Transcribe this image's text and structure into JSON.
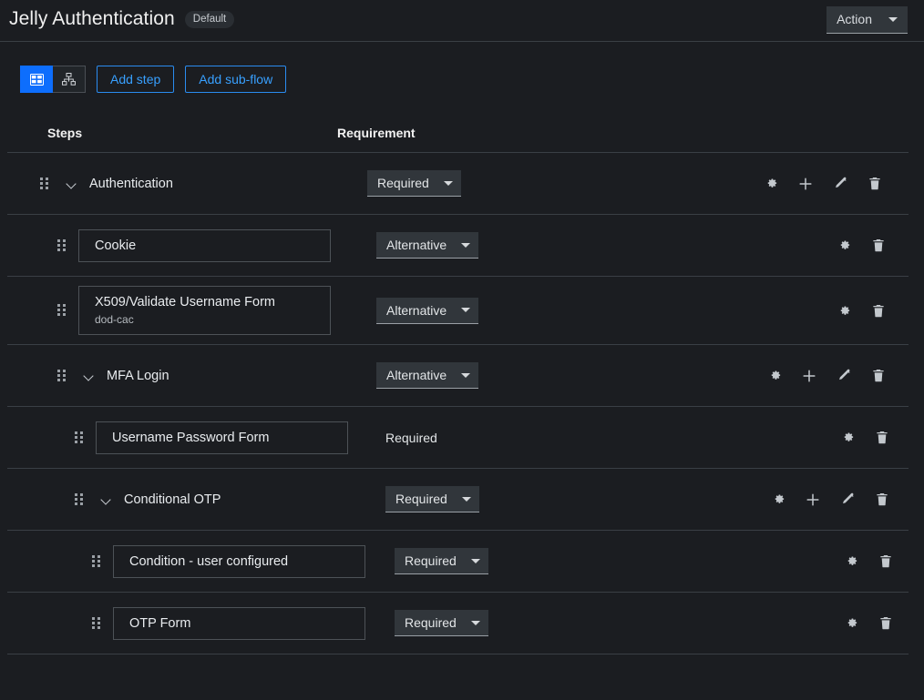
{
  "header": {
    "title": "Jelly Authentication",
    "badge": "Default",
    "action_label": "Action",
    "action_icon": "chevron-down-icon"
  },
  "toolbar": {
    "view_toggles": [
      {
        "name": "table-view",
        "icon": "table-grid-icon",
        "active": true
      },
      {
        "name": "diagram-view",
        "icon": "sitemap-icon",
        "active": false
      }
    ],
    "add_step_label": "Add step",
    "add_subflow_label": "Add sub-flow"
  },
  "table": {
    "columns": {
      "steps": "Steps",
      "requirement": "Requirement"
    },
    "rows": [
      {
        "id": "authentication",
        "kind": "group",
        "indent": 0,
        "label": "Authentication",
        "requirement": "Required",
        "requirement_editable": true,
        "actions": [
          "gear-icon",
          "plus-icon",
          "pencil-icon",
          "trash-icon"
        ]
      },
      {
        "id": "cookie",
        "kind": "step",
        "indent": 1,
        "label": "Cookie",
        "sublabel": "",
        "requirement": "Alternative",
        "requirement_editable": true,
        "actions": [
          "gear-icon",
          "trash-icon"
        ]
      },
      {
        "id": "x509-validate-username-form",
        "kind": "step",
        "indent": 1,
        "label": "X509/Validate Username Form",
        "sublabel": "dod-cac",
        "requirement": "Alternative",
        "requirement_editable": true,
        "actions": [
          "gear-icon",
          "trash-icon"
        ]
      },
      {
        "id": "mfa-login",
        "kind": "group",
        "indent": 1,
        "label": "MFA Login",
        "requirement": "Alternative",
        "requirement_editable": true,
        "actions": [
          "gear-icon",
          "plus-icon",
          "pencil-icon",
          "trash-icon"
        ]
      },
      {
        "id": "username-password-form",
        "kind": "step",
        "indent": 2,
        "label": "Username Password Form",
        "sublabel": "",
        "requirement": "Required",
        "requirement_editable": false,
        "actions": [
          "gear-icon",
          "trash-icon"
        ]
      },
      {
        "id": "conditional-otp",
        "kind": "group",
        "indent": 2,
        "label": "Conditional OTP",
        "requirement": "Required",
        "requirement_editable": true,
        "actions": [
          "gear-icon",
          "plus-icon",
          "pencil-icon",
          "trash-icon"
        ]
      },
      {
        "id": "condition-user-configured",
        "kind": "step",
        "indent": 3,
        "label": "Condition - user configured",
        "sublabel": "",
        "requirement": "Required",
        "requirement_editable": true,
        "actions": [
          "gear-icon",
          "trash-icon"
        ]
      },
      {
        "id": "otp-form",
        "kind": "step",
        "indent": 3,
        "label": "OTP Form",
        "sublabel": "",
        "requirement": "Required",
        "requirement_editable": true,
        "actions": [
          "gear-icon",
          "trash-icon"
        ]
      }
    ]
  },
  "colors": {
    "background": "#1b1d21",
    "accent": "#0d6efd",
    "link": "#38a0ff",
    "border": "#3a3f45",
    "select_bg": "#31363b"
  }
}
